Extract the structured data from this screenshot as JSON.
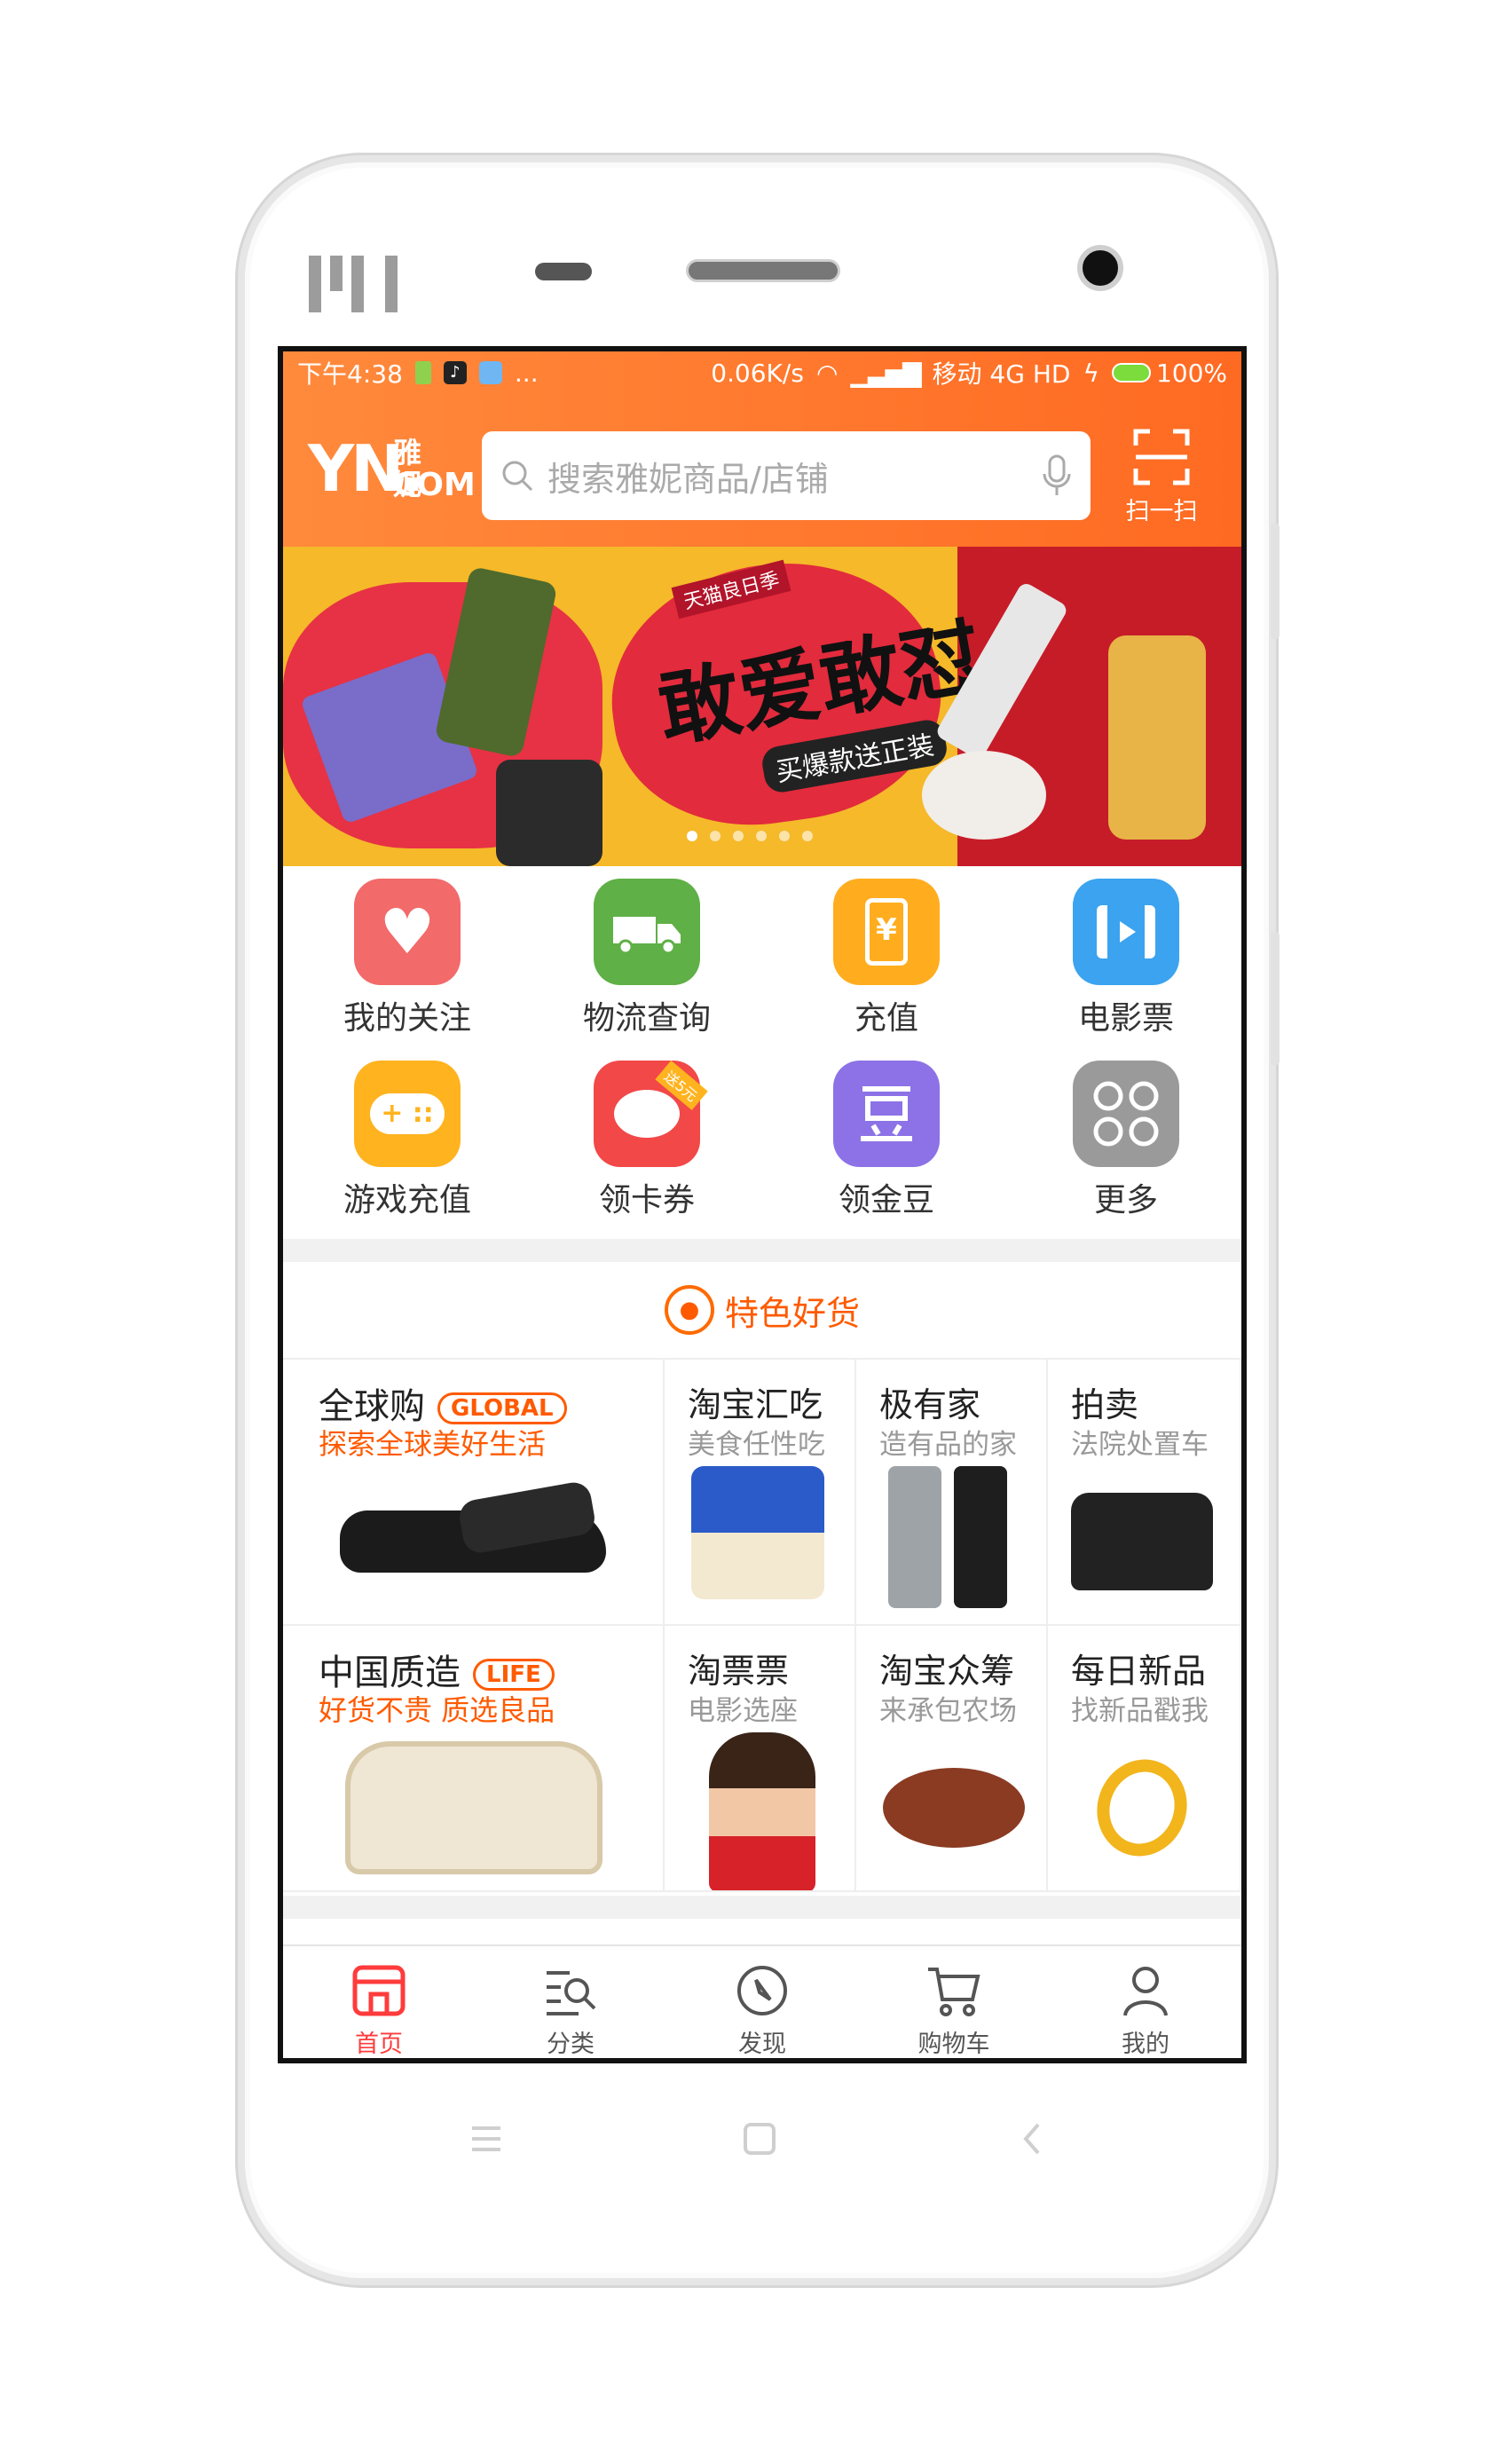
{
  "status": {
    "time": "下午4:38",
    "more": "...",
    "speed": "0.06K/s",
    "carrier": "移动 4G HD",
    "battery": "100%"
  },
  "header": {
    "logo_main": "YN.",
    "logo_cn": "雅妮",
    "logo_com": "COM",
    "search_placeholder": "搜索雅妮商品/店铺",
    "scan_label": "扫一扫"
  },
  "banner": {
    "tag": "天猫良日季",
    "headline": "敢爱敢怼",
    "subline": "买爆款送正装",
    "pages": 6,
    "active_page": 0
  },
  "quick_links": [
    {
      "label": "我的关注",
      "icon": "heart-icon",
      "color": "#f26a6a"
    },
    {
      "label": "物流查询",
      "icon": "truck-icon",
      "color": "#5fb046"
    },
    {
      "label": "充值",
      "icon": "phone-recharge-icon",
      "color": "#ffad1f"
    },
    {
      "label": "电影票",
      "icon": "film-icon",
      "color": "#3ba3ef"
    },
    {
      "label": "游戏充值",
      "icon": "gamepad-icon",
      "color": "#ffb31f"
    },
    {
      "label": "领卡券",
      "icon": "piggy-bank-icon",
      "color": "#f24848"
    },
    {
      "label": "领金豆",
      "icon": "bean-icon",
      "color": "#8c72e6"
    },
    {
      "label": "更多",
      "icon": "more-grid-icon",
      "color": "#9a9a9a"
    }
  ],
  "section": {
    "title": "特色好货"
  },
  "features": {
    "global": {
      "title": "全球购",
      "badge": "GLOBAL",
      "subtitle": "探索全球美好生活"
    },
    "food": {
      "title": "淘宝汇吃",
      "subtitle": "美食任性吃"
    },
    "home": {
      "title": "极有家",
      "subtitle": "造有品的家"
    },
    "auction": {
      "title": "拍卖",
      "subtitle": "法院处置车"
    },
    "china": {
      "title": "中国质造",
      "badge": "LIFE",
      "subtitle": "好货不贵 质选良品"
    },
    "tickets": {
      "title": "淘票票",
      "subtitle": "电影选座"
    },
    "crowd": {
      "title": "淘宝众筹",
      "subtitle": "来承包农场"
    },
    "daily": {
      "title": "每日新品",
      "subtitle": "找新品戳我"
    }
  },
  "tabs": [
    {
      "label": "首页",
      "icon": "home-store-icon",
      "active": true
    },
    {
      "label": "分类",
      "icon": "category-search-icon",
      "active": false
    },
    {
      "label": "发现",
      "icon": "compass-icon",
      "active": false
    },
    {
      "label": "购物车",
      "icon": "cart-icon",
      "active": false
    },
    {
      "label": "我的",
      "icon": "user-icon",
      "active": false
    }
  ],
  "colors": {
    "accent": "#ff6a22",
    "tab_active": "#ff3b3b"
  }
}
